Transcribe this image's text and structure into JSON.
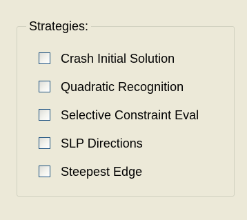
{
  "strategies": {
    "title": "Strategies:",
    "options": [
      {
        "label": "Crash Initial Solution",
        "checked": false
      },
      {
        "label": "Quadratic Recognition",
        "checked": false
      },
      {
        "label": "Selective Constraint Eval",
        "checked": false
      },
      {
        "label": "SLP Directions",
        "checked": false
      },
      {
        "label": "Steepest Edge",
        "checked": false
      }
    ]
  },
  "colors": {
    "background": "#ece9d8",
    "group_border": "#d0d0bf",
    "checkbox_border": "#1c5180"
  }
}
